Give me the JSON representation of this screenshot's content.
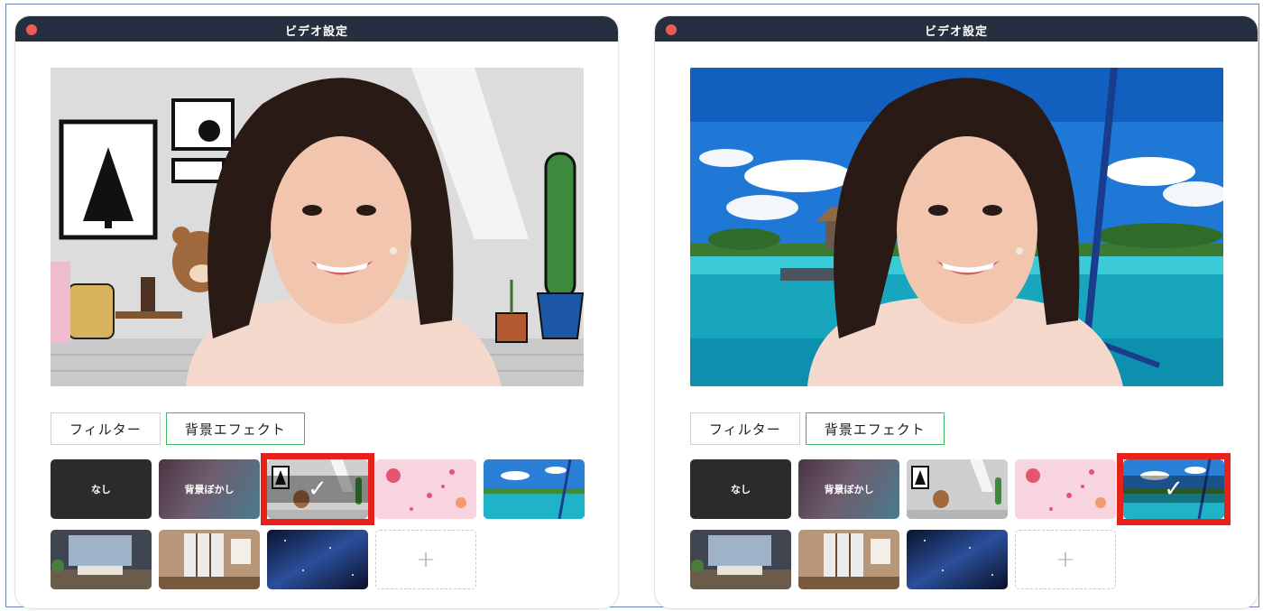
{
  "windows": [
    {
      "title": "ビデオ設定",
      "background": "room",
      "tabs": [
        {
          "label": "フィルター",
          "active": false
        },
        {
          "label": "背景エフェクト",
          "active": true
        }
      ],
      "thumbnails": [
        {
          "label": "なし",
          "kind": "none"
        },
        {
          "label": "背景ぼかし",
          "kind": "blur"
        },
        {
          "label": "",
          "kind": "room",
          "selected": true
        },
        {
          "label": "",
          "kind": "hearts"
        },
        {
          "label": "",
          "kind": "beach"
        },
        {
          "label": "",
          "kind": "office"
        },
        {
          "label": "",
          "kind": "interior"
        },
        {
          "label": "",
          "kind": "space"
        },
        {
          "label": "+",
          "kind": "add"
        }
      ]
    },
    {
      "title": "ビデオ設定",
      "background": "beach",
      "tabs": [
        {
          "label": "フィルター",
          "active": false
        },
        {
          "label": "背景エフェクト",
          "active": true
        }
      ],
      "thumbnails": [
        {
          "label": "なし",
          "kind": "none"
        },
        {
          "label": "背景ぼかし",
          "kind": "blur"
        },
        {
          "label": "",
          "kind": "room"
        },
        {
          "label": "",
          "kind": "hearts"
        },
        {
          "label": "",
          "kind": "beach",
          "selected": true
        },
        {
          "label": "",
          "kind": "office"
        },
        {
          "label": "",
          "kind": "interior"
        },
        {
          "label": "",
          "kind": "space"
        },
        {
          "label": "+",
          "kind": "add"
        }
      ]
    }
  ],
  "colors": {
    "titlebar": "#262f3f",
    "close_button": "#ee5b52",
    "active_tab_border": "#41b85f",
    "selection": "#e8221b"
  },
  "icons": {
    "checkmark": "✓",
    "add": "+"
  }
}
